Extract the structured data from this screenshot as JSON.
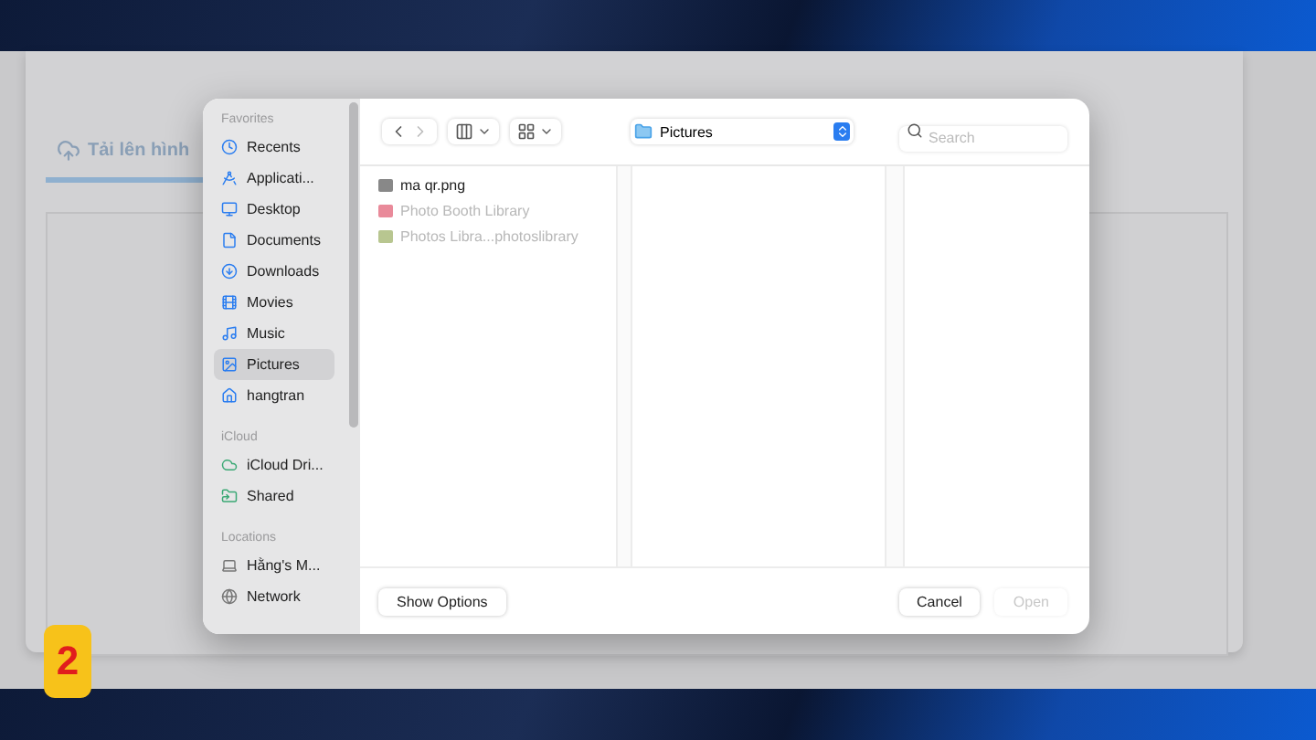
{
  "background_page": {
    "tab": {
      "label": "Tải lên hình",
      "selected": true
    }
  },
  "dialog": {
    "sidebar": [
      {
        "heading": "Favorites",
        "items": [
          {
            "label": "Recents",
            "kind": "recents",
            "selected": false
          },
          {
            "label": "Applicati...",
            "kind": "apps",
            "selected": false
          },
          {
            "label": "Desktop",
            "kind": "desktop",
            "selected": false
          },
          {
            "label": "Documents",
            "kind": "documents",
            "selected": false
          },
          {
            "label": "Downloads",
            "kind": "downloads",
            "selected": false
          },
          {
            "label": "Movies",
            "kind": "movies",
            "selected": false
          },
          {
            "label": "Music",
            "kind": "music",
            "selected": false
          },
          {
            "label": "Pictures",
            "kind": "pictures",
            "selected": true
          },
          {
            "label": "hangtran",
            "kind": "home",
            "selected": false
          }
        ]
      },
      {
        "heading": "iCloud",
        "items": [
          {
            "label": "iCloud Dri...",
            "kind": "icloud",
            "selected": false
          },
          {
            "label": "Shared",
            "kind": "shared",
            "selected": false
          }
        ]
      },
      {
        "heading": "Locations",
        "items": [
          {
            "label": "Hằng's M...",
            "kind": "computer",
            "selected": false
          },
          {
            "label": "Network",
            "kind": "network",
            "selected": false
          }
        ]
      }
    ],
    "location": "Pictures",
    "search": {
      "placeholder": "Search"
    },
    "files": [
      {
        "name": "ma qr.png",
        "kind": "image",
        "disabled": false
      },
      {
        "name": "Photo Booth Library",
        "kind": "photobooth",
        "disabled": true
      },
      {
        "name": "Photos Libra...photoslibrary",
        "kind": "photoslibrary",
        "disabled": true
      }
    ],
    "show_options": "Show Options",
    "cancel": {
      "label": "Cancel",
      "disabled": false
    },
    "open": {
      "label": "Open",
      "disabled": true
    }
  },
  "badge": "2"
}
